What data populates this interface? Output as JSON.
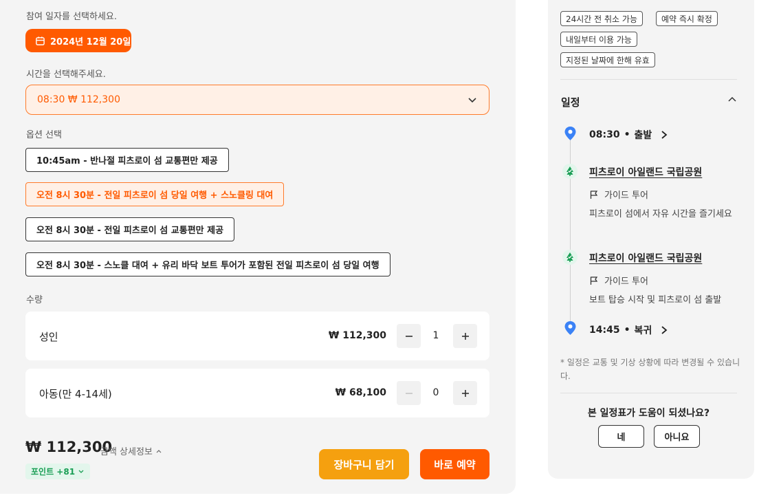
{
  "booking": {
    "date_prompt": "참여 일자를 선택하세요.",
    "selected_date": "2024년 12월 20일",
    "time_prompt": "시간을 선택해주세요.",
    "selected_time": "08:30 ₩ 112,300",
    "option_prompt": "옵션 선택",
    "options": [
      {
        "label": "10:45am - 반나절 피츠로이 섬 교통편만 제공",
        "selected": false
      },
      {
        "label": "오전 8시 30분 - 전일 피츠로이 섬 당일 여행 + 스노클링 대여",
        "selected": true
      },
      {
        "label": "오전 8시 30분 - 전일 피츠로이 섬 교통편만 제공",
        "selected": false
      },
      {
        "label": "오전 8시 30분 - 스노클 대여 + 유리 바닥 보트 투어가 포함된 전일 피츠로이 섬 당일 여행",
        "selected": false
      }
    ],
    "quantity_prompt": "수량",
    "quantities": [
      {
        "name": "성인",
        "price": "₩ 112,300",
        "count": "1"
      },
      {
        "name": "아동(만 4-14세)",
        "price": "₩ 68,100",
        "count": "0"
      }
    ]
  },
  "footer": {
    "total": "₩ 112,300",
    "detail_link": "금액 상세정보",
    "points": "포인트 +81",
    "cart_button": "장바구니 담기",
    "book_button": "바로 예약"
  },
  "tags": [
    "24시간 전 취소 가능",
    "예약 즉시 확정",
    "내일부터 이용 가능",
    "지정된 날짜에 한해 유효"
  ],
  "schedule": {
    "title": "일정",
    "start": {
      "time": "08:30",
      "label": "출발"
    },
    "stops": [
      {
        "place": "피츠로이 아일랜드 국립공원",
        "type": "가이드 투어",
        "desc": "피츠로이 섬에서 자유 시간을 즐기세요"
      },
      {
        "place": "피츠로이 아일랜드 국립공원",
        "type": "가이드 투어",
        "desc": "보트 탑승 시작 및 피츠로이 섬 출발"
      }
    ],
    "end": {
      "time": "14:45",
      "label": "복귀"
    },
    "note": "* 일정은 교통 및 기상 상황에 따라 변경될 수 있습니다.",
    "feedback_question": "본 일정표가 도움이 되셨나요?",
    "yes_label": "네",
    "no_label": "아니요"
  },
  "colors": {
    "accent": "#ff5a00",
    "cart": "#f5a00f",
    "pin": "#3b82f6",
    "park": "#1a9e55"
  }
}
